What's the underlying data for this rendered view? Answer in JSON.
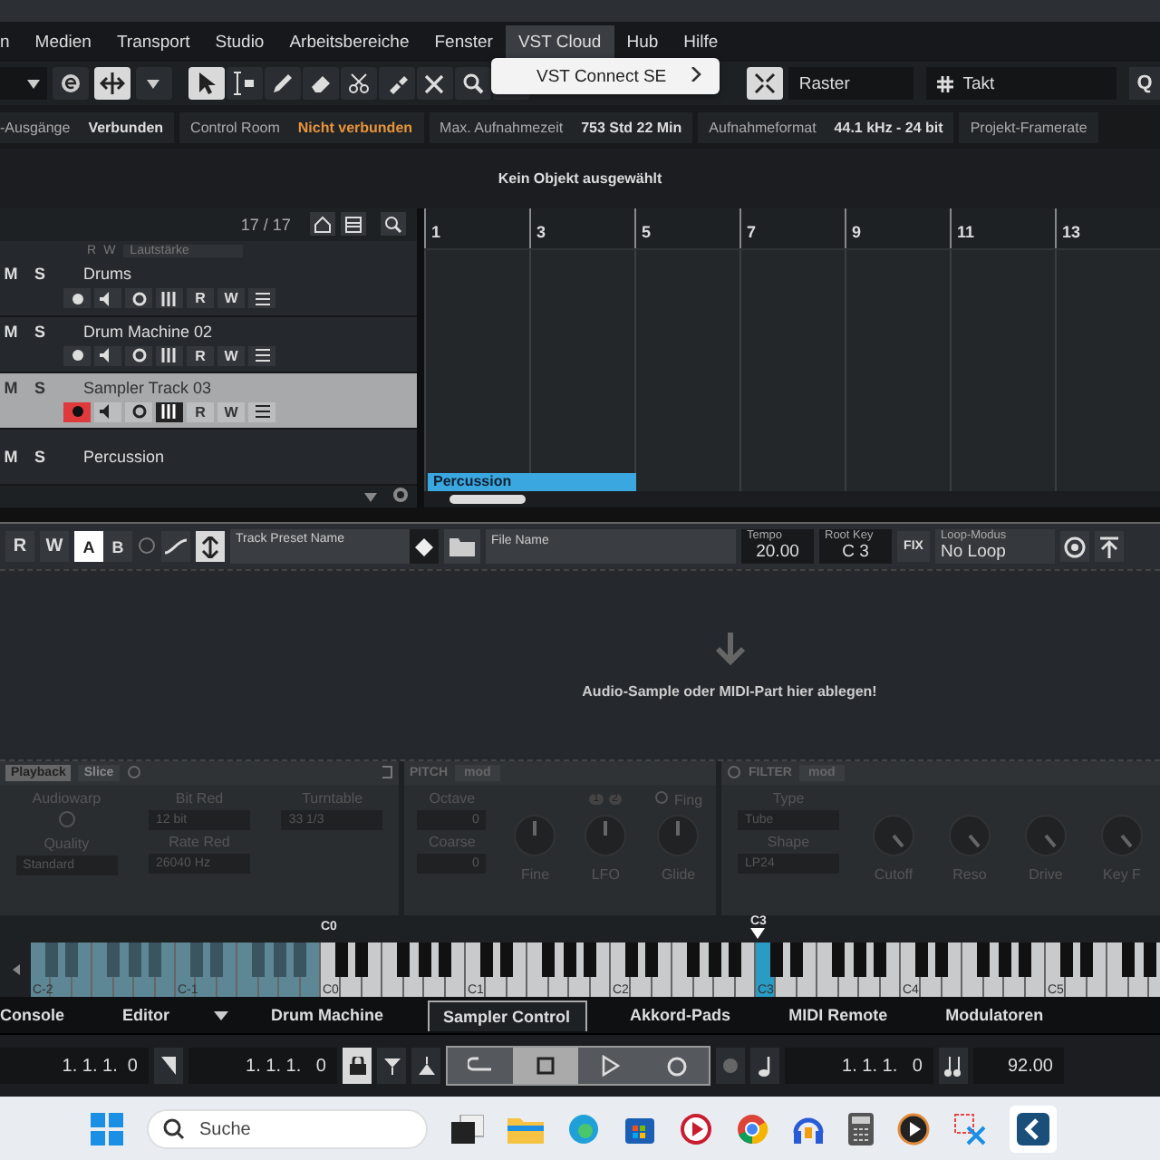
{
  "menu_bar": {
    "items": [
      {
        "label": "n",
        "selected": false
      },
      {
        "label": "Medien",
        "selected": false
      },
      {
        "label": "Transport",
        "selected": false
      },
      {
        "label": "Studio",
        "selected": false
      },
      {
        "label": "Arbeitsbereiche",
        "selected": false
      },
      {
        "label": "Fenster",
        "selected": false
      },
      {
        "label": "VST Cloud",
        "selected": true
      },
      {
        "label": "Hub",
        "selected": false
      },
      {
        "label": "Hilfe",
        "selected": false
      }
    ]
  },
  "menu_popup": {
    "items": [
      {
        "label": "VST Connect SE",
        "submenu": true
      }
    ]
  },
  "toolbar": {
    "snap_mode": "Raster",
    "grid_type": "Takt",
    "quantize": "Q"
  },
  "status_line": [
    {
      "label": "-Ausgänge",
      "value": "Verbunden",
      "warning": false
    },
    {
      "label": "Control Room",
      "value": "Nicht verbunden",
      "warning": true
    },
    {
      "label": "Max. Aufnahmezeit",
      "value": "753 Std 22 Min",
      "warning": false
    },
    {
      "label": "Aufnahmeformat",
      "value": "44.1 kHz - 24 bit",
      "warning": false
    },
    {
      "label": "Projekt-Framerate"
    }
  ],
  "info_line": {
    "text": "Kein Objekt ausgewählt"
  },
  "track_list": {
    "counter": "17 / 17",
    "automation_row": [
      "R",
      "W",
      "Lautstärke"
    ],
    "tracks": [
      {
        "mute": "M",
        "solo": "S",
        "name": "Drums",
        "selected": false,
        "record_armed": false,
        "buttons": [
          "R",
          "W"
        ]
      },
      {
        "mute": "M",
        "solo": "S",
        "name": "Drum Machine 02",
        "selected": false,
        "record_armed": false,
        "buttons": [
          "R",
          "W"
        ]
      },
      {
        "mute": "M",
        "solo": "S",
        "name": "Sampler Track 03",
        "selected": true,
        "record_armed": true,
        "buttons": [
          "R",
          "W"
        ]
      },
      {
        "mute": "M",
        "solo": "S",
        "name": "Percussion",
        "selected": false
      }
    ]
  },
  "arrange": {
    "ruler": [
      "1",
      "3",
      "5",
      "7",
      "9",
      "11",
      "13"
    ],
    "part": {
      "name": "Percussion"
    }
  },
  "sampler_control": {
    "rw": [
      "R",
      "W"
    ],
    "ab": [
      {
        "label": "A",
        "selected": true
      },
      {
        "label": "B",
        "selected": false
      }
    ],
    "preset_placeholder": "Track Preset Name",
    "file_placeholder": "File Name",
    "tempo": {
      "label": "Tempo",
      "value": "20.00"
    },
    "root_key": {
      "label": "Root Key",
      "value": "C 3"
    },
    "fix": "FIX",
    "loop": {
      "label": "Loop-Modus",
      "value": "No Loop"
    },
    "drop_hint": "Audio-Sample oder MIDI-Part hier ablegen!"
  },
  "sampler_params": {
    "tabs": [
      {
        "label": "Playback",
        "selected": true
      },
      {
        "label": "Slice",
        "selected": false
      }
    ],
    "audiowarp": "Audiowarp",
    "quality": {
      "label": "Quality",
      "value": "Standard"
    },
    "bit_red": {
      "label": "Bit Red",
      "value": "12 bit"
    },
    "rate_red": {
      "label": "Rate Red",
      "value": "26040 Hz"
    },
    "turntable": {
      "label": "Turntable",
      "value": "33 1/3"
    },
    "pitch": {
      "title": "PITCH",
      "mod": "mod",
      "octave": {
        "label": "Octave",
        "value": "0"
      },
      "coarse": {
        "label": "Coarse",
        "value": "0"
      },
      "lfo_tabs": [
        "1",
        "2"
      ],
      "fing": "Fing",
      "knobs": [
        "Fine",
        "LFO",
        "Glide"
      ]
    },
    "filter": {
      "title": "FILTER",
      "mod": "mod",
      "type": {
        "label": "Type",
        "value": "Tube"
      },
      "shape": {
        "label": "Shape",
        "value": "LP24"
      },
      "knobs": [
        "Cutoff",
        "Reso",
        "Drive",
        "Key F"
      ]
    }
  },
  "keyboard": {
    "range_marker": "C0",
    "root_marker": "C3",
    "octaves": [
      {
        "label": "C-2",
        "in_range": false,
        "root": false
      },
      {
        "label": "C-1",
        "in_range": false,
        "root": false
      },
      {
        "label": "C0",
        "in_range": true,
        "root": false
      },
      {
        "label": "C1",
        "in_range": true,
        "root": false
      },
      {
        "label": "C2",
        "in_range": true,
        "root": false
      },
      {
        "label": "C3",
        "in_range": true,
        "root": true
      },
      {
        "label": "C4",
        "in_range": true,
        "root": false
      },
      {
        "label": "C5",
        "in_range": true,
        "root": false
      }
    ]
  },
  "bottom_tabs": [
    {
      "label": "Console",
      "selected": false
    },
    {
      "label": "Editor",
      "selected": false,
      "dropdown": true
    },
    {
      "label": "Drum Machine",
      "selected": false
    },
    {
      "label": "Sampler Control",
      "selected": true
    },
    {
      "label": "Akkord-Pads",
      "selected": false
    },
    {
      "label": "MIDI Remote",
      "selected": false
    },
    {
      "label": "Modulatoren",
      "selected": false
    }
  ],
  "transport": {
    "left_locator": "1. 1. 1.  0",
    "position": "1. 1. 1.   0",
    "right_position": "1. 1. 1.   0",
    "tempo": "92.00"
  },
  "taskbar": {
    "search_placeholder": "Suche"
  }
}
